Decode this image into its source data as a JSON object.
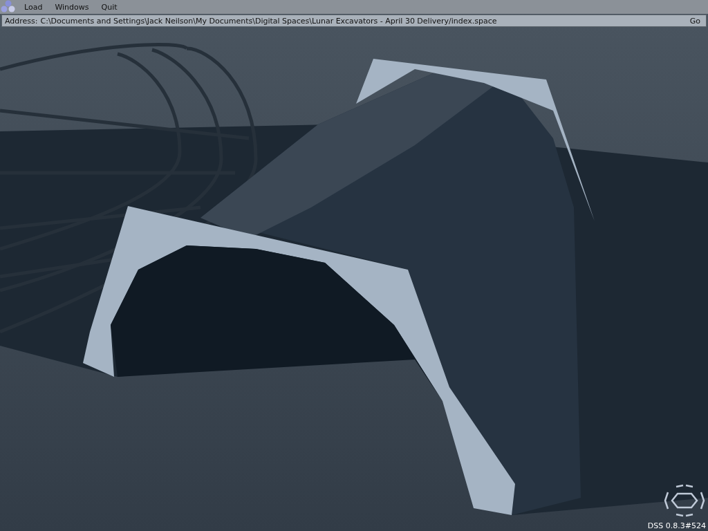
{
  "menu_bar": {
    "items": [
      {
        "label": "Load"
      },
      {
        "label": "Windows"
      },
      {
        "label": "Quit"
      }
    ]
  },
  "address_bar": {
    "label": "Address:",
    "value": "C:\\Documents and Settings\\Jack Neilson\\My Documents\\Digital Spaces\\Lunar Excavators - April 30 Delivery/index.space",
    "button": "Go"
  },
  "version": "DSS 0.8.3#524"
}
